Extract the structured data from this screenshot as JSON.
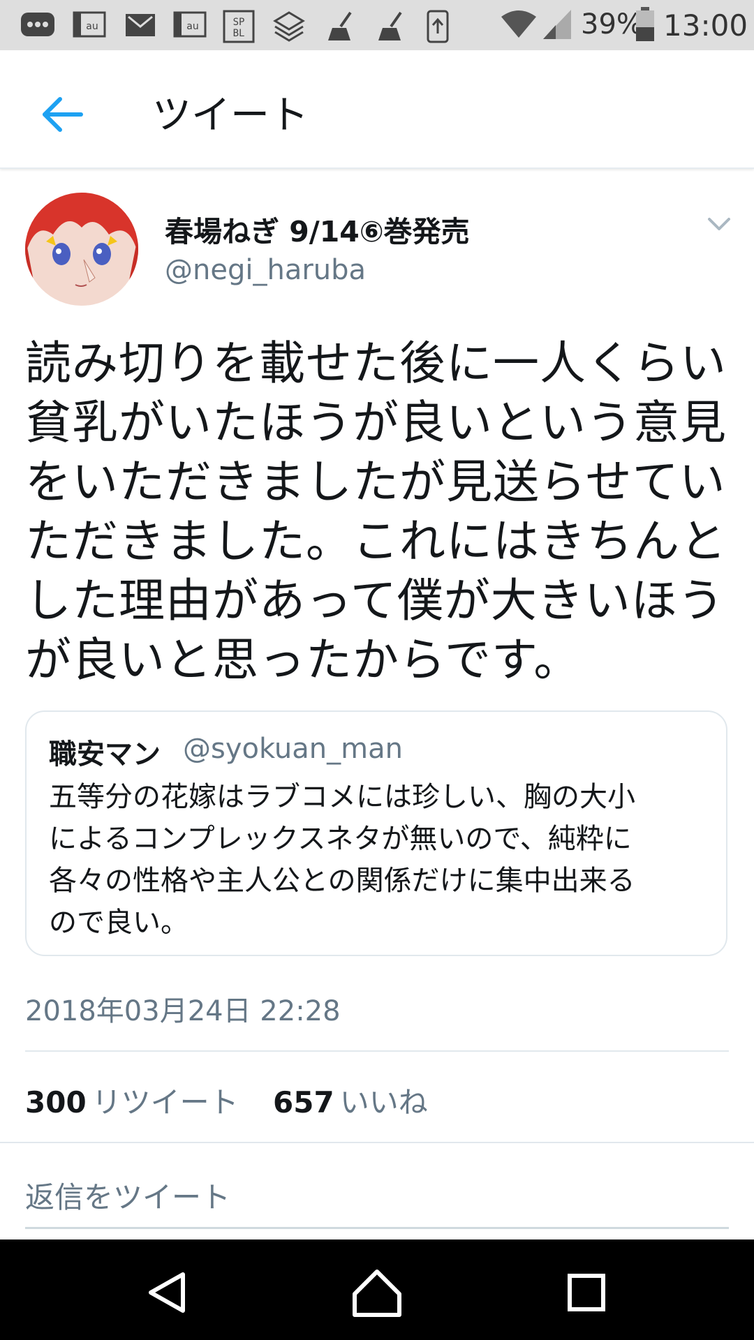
{
  "status_bar": {
    "battery": "39%",
    "time": "13:00",
    "left_icons": [
      "message-icon",
      "au-icon",
      "gmail-icon",
      "au-icon",
      "spbl-icon",
      "layers-icon",
      "broom-icon",
      "broom-icon",
      "upload-icon"
    ],
    "right_icons": [
      "wifi-icon",
      "signal-icon",
      "battery-icon"
    ]
  },
  "header": {
    "title": "ツイート",
    "back_icon": "arrow-left-icon",
    "accent_color": "#1da1f2"
  },
  "tweet": {
    "author_name": "春場ねぎ 9/14⑥巻発売",
    "author_handle": "@negi_haruba",
    "text_lines": [
      "読み切りを載せた後に一人くらい",
      "貧乳がいたほうが良いという意見",
      "をいただきましたが見送らせてい",
      "ただきました。これにはきちんと",
      "した理由があって僕が大きいほう",
      "が良いと思ったからです。"
    ],
    "quoted": {
      "name": "職安マン",
      "handle": "@syokuan_man",
      "text_lines": [
        "五等分の花嫁はラブコメには珍しい、胸の大小",
        "によるコンプレックスネタが無いので、純粋に",
        "各々の性格や主人公との関係だけに集中出来る",
        "ので良い。"
      ]
    },
    "timestamp": "2018年03月24日 22:28",
    "retweet_count": "300",
    "retweet_label": "リツイート",
    "like_count": "657",
    "like_label": "いいね"
  },
  "reply": {
    "placeholder": "返信をツイート"
  },
  "nav_bar": {
    "icons": [
      "back-triangle-icon",
      "home-icon",
      "recents-icon"
    ]
  }
}
